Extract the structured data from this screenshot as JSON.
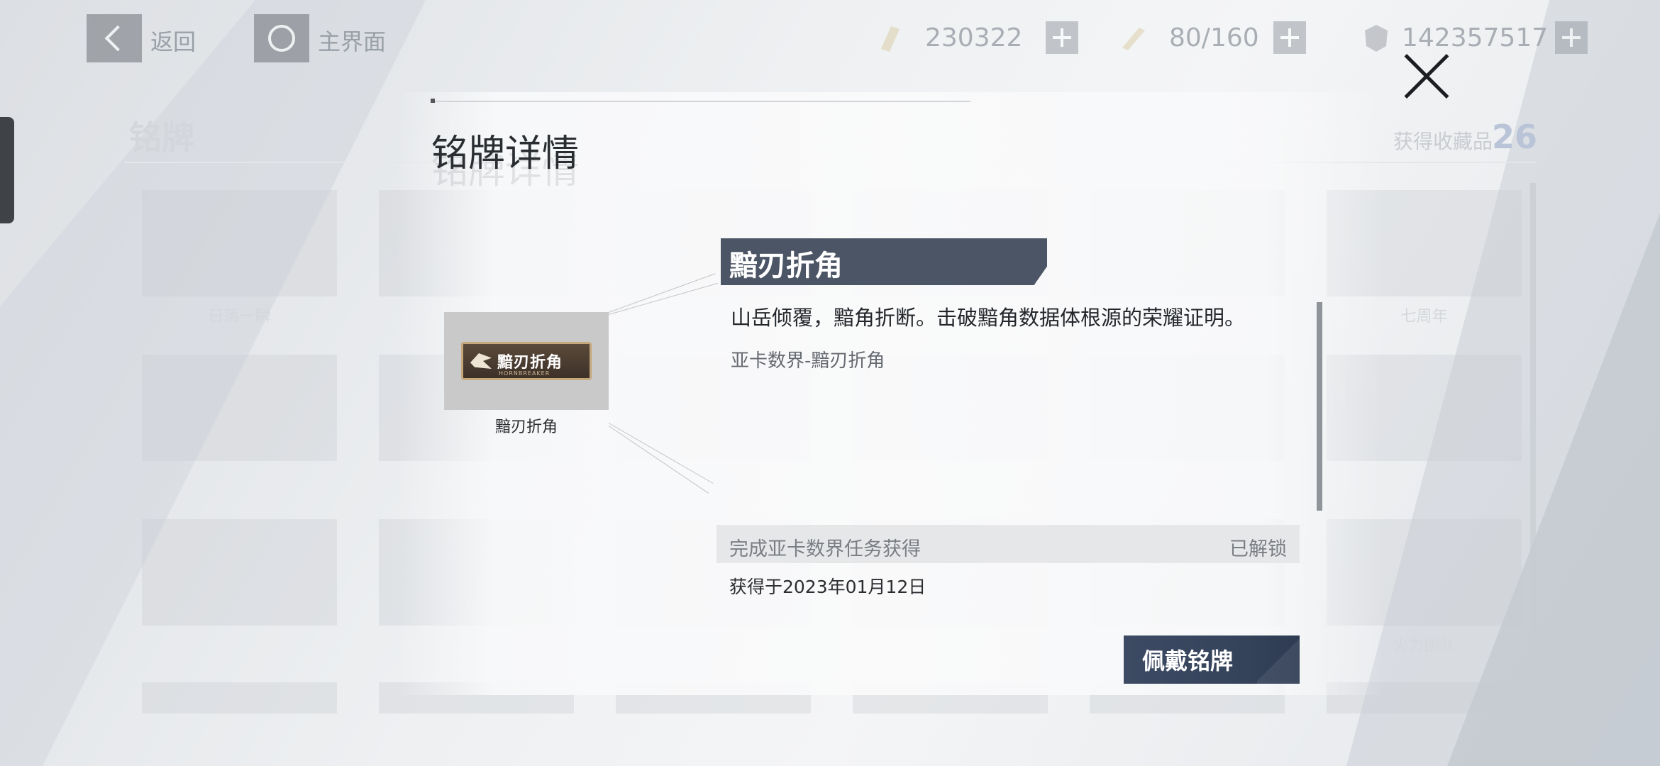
{
  "topbar": {
    "back_label": "返回",
    "home_label": "主界面",
    "resources": [
      {
        "icon": "ticket-icon",
        "value": "230322"
      },
      {
        "icon": "energy-icon",
        "value": "80/160"
      },
      {
        "icon": "coin-icon",
        "value": "142357517"
      }
    ]
  },
  "background_page": {
    "title": "铭牌",
    "collect_label": "获得收藏品",
    "collect_count": "26",
    "card_labels": [
      "日落一瞬",
      "",
      "",
      "",
      "",
      "七周年",
      "",
      "",
      "",
      "",
      "",
      "",
      "",
      "",
      "",
      "",
      "",
      "火力团队"
    ]
  },
  "modal": {
    "title": "铭牌详情",
    "badge": {
      "plate_text": "黯刃折角",
      "plate_subtext": "HORNBREAKER",
      "name": "黯刃折角"
    },
    "detail": {
      "name": "黯刃折角",
      "description": "山岳倾覆，黯角折断。击破黯角数据体根源的荣耀证明。",
      "source": "亚卡数界-黯刃折角",
      "unlock_condition": "完成亚卡数界任务获得",
      "unlock_status": "已解锁",
      "obtained_date": "获得于2023年01月12日"
    },
    "wear_button_label": "佩戴铭牌"
  },
  "colors": {
    "header_bg": "#4c5565",
    "button_bg": "#3c4a63",
    "accent_count": "#b9c4d8"
  }
}
